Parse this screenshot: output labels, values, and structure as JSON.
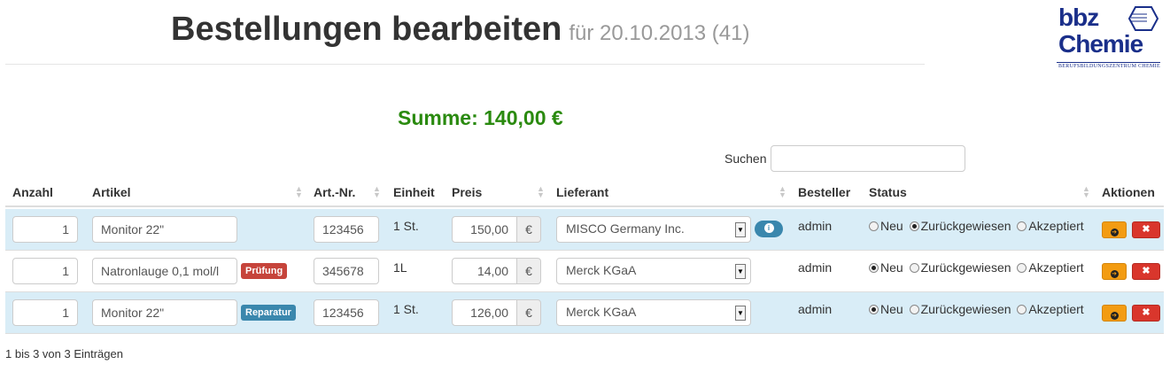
{
  "header": {
    "title": "Bestellungen bearbeiten",
    "subtitle": "für 20.10.2013 (41)"
  },
  "logo": {
    "line1": "bbz",
    "line2": "Chemie",
    "tagline": "Berufsbildungszentrum Chemie"
  },
  "summary": {
    "label": "Summe: 140,00 €"
  },
  "search": {
    "label": "Suchen",
    "value": ""
  },
  "table": {
    "columns": [
      "Anzahl",
      "Artikel",
      "Art.-Nr.",
      "Einheit",
      "Preis",
      "Lieferant",
      "Besteller",
      "Status",
      "Aktionen"
    ],
    "currency": "€",
    "status_options": [
      "Neu",
      "Zurückgewiesen",
      "Akzeptiert"
    ],
    "rows": [
      {
        "qty": "1",
        "article": "Monitor 22\"",
        "tag": "",
        "artnr": "123456",
        "unit": "1 St.",
        "price": "150,00",
        "supplier": "MISCO Germany Inc.",
        "orderer": "admin",
        "status": "Zurückgewiesen"
      },
      {
        "qty": "1",
        "article": "Natronlauge 0,1 mol/l",
        "tag": "Prüfung",
        "artnr": "345678",
        "unit": "1L",
        "price": "14,00",
        "supplier": "Merck KGaA",
        "orderer": "admin",
        "status": "Neu"
      },
      {
        "qty": "1",
        "article": "Monitor 22\"",
        "tag": "Reparatur",
        "artnr": "123456",
        "unit": "1 St.",
        "price": "126,00",
        "supplier": "Merck KGaA",
        "orderer": "admin",
        "status": "Neu"
      }
    ]
  },
  "footer": {
    "info": "1 bis 3 von 3 Einträgen"
  },
  "colors": {
    "sum_green": "#2a8a0f",
    "row_highlight": "#d9edf7",
    "label_red": "#c6443b",
    "label_blue": "#3a87ad",
    "btn_orange": "#f39c12",
    "btn_red": "#d9362c"
  }
}
